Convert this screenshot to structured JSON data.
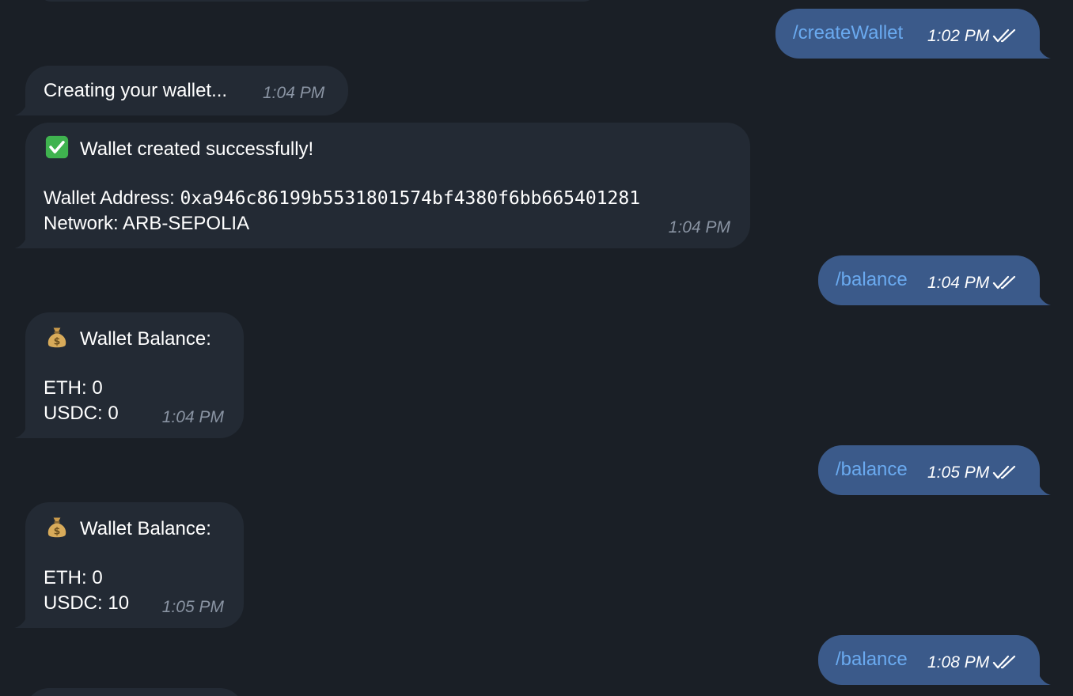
{
  "colors": {
    "background": "#1a1f26",
    "incoming_bubble": "#232a34",
    "outgoing_bubble": "#3b5a8a",
    "command_link": "#6aaaf0",
    "incoming_time": "#8a94a3"
  },
  "messages": [
    {
      "direction": "outgoing",
      "text": "/createWallet",
      "time": "1:02 PM",
      "status": "read-double-check-icon"
    },
    {
      "direction": "incoming",
      "text": "Creating your wallet...",
      "time": "1:04 PM"
    },
    {
      "direction": "incoming",
      "icon": "check-mark-button-emoji",
      "heading": "Wallet created successfully!",
      "address_label": "Wallet Address: ",
      "address_value": "0xa946c86199b5531801574bf4380f6bb665401281",
      "network_line": "Network: ARB-SEPOLIA",
      "time": "1:04 PM"
    },
    {
      "direction": "outgoing",
      "text": "/balance",
      "time": "1:04 PM",
      "status": "read-double-check-icon"
    },
    {
      "direction": "incoming",
      "icon": "money-bag-emoji",
      "heading": "Wallet Balance:",
      "lines": [
        "ETH: 0",
        "USDC: 0"
      ],
      "time": "1:04 PM"
    },
    {
      "direction": "outgoing",
      "text": "/balance",
      "time": "1:05 PM",
      "status": "read-double-check-icon"
    },
    {
      "direction": "incoming",
      "icon": "money-bag-emoji",
      "heading": "Wallet Balance:",
      "lines": [
        "ETH: 0",
        "USDC: 10"
      ],
      "time": "1:05 PM"
    },
    {
      "direction": "outgoing",
      "text": "/balance",
      "time": "1:08 PM",
      "status": "read-double-check-icon"
    }
  ]
}
